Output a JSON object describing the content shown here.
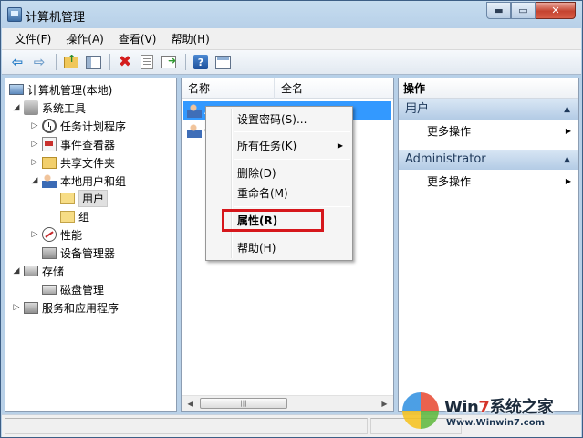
{
  "window": {
    "title": "计算机管理"
  },
  "menubar": {
    "items": [
      "文件(F)",
      "操作(A)",
      "查看(V)",
      "帮助(H)"
    ]
  },
  "toolbar": {
    "buttons": [
      "back-icon",
      "forward-icon",
      "up-folder-icon",
      "show-hide-tree-icon",
      "delete-icon",
      "properties-icon",
      "export-icon",
      "help-icon",
      "view-icon"
    ]
  },
  "tree": {
    "items": [
      {
        "label": "计算机管理(本地)",
        "icon": "computer-icon"
      },
      {
        "label": "系统工具",
        "icon": "tools-icon"
      },
      {
        "label": "任务计划程序",
        "icon": "clock-icon"
      },
      {
        "label": "事件查看器",
        "icon": "event-viewer-icon"
      },
      {
        "label": "共享文件夹",
        "icon": "shared-folder-icon"
      },
      {
        "label": "本地用户和组",
        "icon": "users-groups-icon"
      },
      {
        "label": "用户",
        "icon": "folder-icon"
      },
      {
        "label": "组",
        "icon": "folder-icon"
      },
      {
        "label": "性能",
        "icon": "performance-icon"
      },
      {
        "label": "设备管理器",
        "icon": "device-manager-icon"
      },
      {
        "label": "存储",
        "icon": "storage-icon"
      },
      {
        "label": "磁盘管理",
        "icon": "disk-icon"
      },
      {
        "label": "服务和应用程序",
        "icon": "services-icon"
      }
    ]
  },
  "list": {
    "columns": [
      "名称",
      "全名"
    ],
    "rows": [
      {
        "name": "A",
        "selected": true
      },
      {
        "name": "G",
        "selected": false
      }
    ]
  },
  "context_menu": {
    "items": [
      "设置密码(S)...",
      "所有任务(K)",
      "删除(D)",
      "重命名(M)",
      "属性(R)",
      "帮助(H)"
    ]
  },
  "actions": {
    "title": "操作",
    "sections": [
      {
        "header": "用户",
        "item": "更多操作"
      },
      {
        "header": "Administrator",
        "item": "更多操作"
      }
    ]
  },
  "watermark": {
    "brand_prefix": "Win",
    "brand_num": "7",
    "brand_suffix": "系统之家",
    "url": "Www.Winwin7.com"
  },
  "colors": {
    "selection": "#3399ff",
    "highlight_box": "#d6171c",
    "section_header": "#b3cbe5"
  }
}
